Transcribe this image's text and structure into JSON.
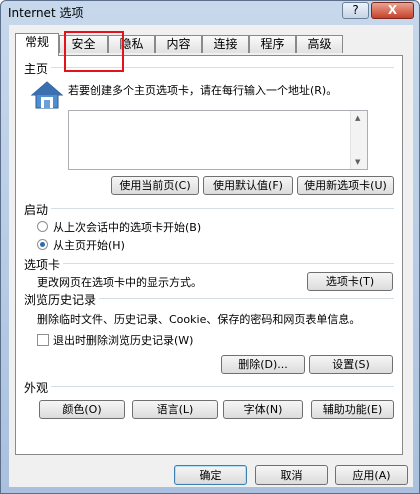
{
  "window": {
    "title": "Internet 选项",
    "help_label": "?",
    "close_label": "X"
  },
  "tabs": [
    {
      "label": "常规"
    },
    {
      "label": "安全"
    },
    {
      "label": "隐私"
    },
    {
      "label": "内容"
    },
    {
      "label": "连接"
    },
    {
      "label": "程序"
    },
    {
      "label": "高级"
    }
  ],
  "homepage": {
    "group_label": "主页",
    "description": "若要创建多个主页选项卡，请在每行输入一个地址(R)。",
    "value": "",
    "btn_current": "使用当前页(C)",
    "btn_default": "使用默认值(F)",
    "btn_new_tab": "使用新选项卡(U)"
  },
  "startup": {
    "group_label": "启动",
    "option_last": "从上次会话中的选项卡开始(B)",
    "option_home": "从主页开始(H)"
  },
  "tabs_section": {
    "group_label": "选项卡",
    "description": "更改网页在选项卡中的显示方式。",
    "btn_tabs": "选项卡(T)"
  },
  "history": {
    "group_label": "浏览历史记录",
    "description": "删除临时文件、历史记录、Cookie、保存的密码和网页表单信息。",
    "checkbox_label": "退出时删除浏览历史记录(W)",
    "btn_delete": "删除(D)...",
    "btn_settings": "设置(S)"
  },
  "appearance": {
    "group_label": "外观",
    "btn_colors": "颜色(O)",
    "btn_languages": "语言(L)",
    "btn_fonts": "字体(N)",
    "btn_accessibility": "辅助功能(E)"
  },
  "footer": {
    "ok": "确定",
    "cancel": "取消",
    "apply": "应用(A)"
  }
}
